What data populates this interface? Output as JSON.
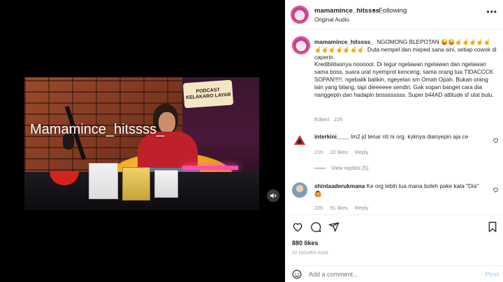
{
  "video": {
    "watermark": "Mamamince_hitssss_",
    "sign_text": "PODCAST KELAKARO LAYAR"
  },
  "header": {
    "username": "mamamince_hitssss_",
    "separator": "•",
    "follow_status": "Following",
    "audio": "Original Audio",
    "more": "•••"
  },
  "caption": {
    "username": "mamamince_hitssss_",
    "text": "NGOMONG BLEPOTAN 😜😜☝☝☝☝☝☝☝☝☝☝☝☝. Duta nempel dan meped sana sini, setiap cowok di caperin.\nKredibilitasnya noooool. Di tegur ngelawan ngelawan dan ngelawan sama boss, suara urat nyemprot kenceng, sama orang tua TIDACCCK SOPAN!!!!!. ngebalik balikin, ngeyelan sm Omah Opah. Bukan orang lain yang bilang, tapi dieeeeee sendiri. Gak sopan banget cara dia nanggepin dan hadapin bossssssss. Super b44AD attitude sf ulat bulu.",
    "meta": "Edited · 22h"
  },
  "comments": [
    {
      "username": "interkini____",
      "text": "lm2 jd tenar nti ni org. kyknya dianyepin aja ce",
      "time": "21h",
      "likes": "22 likes",
      "reply": "Reply"
    },
    {
      "username": "shintaaderukmana",
      "text": "Ke org lebih tua mana boleh pake kata \"Dia\" 🙆",
      "time": "22h",
      "likes": "91 likes",
      "reply": "Reply"
    }
  ],
  "view_replies": "View replies (5)",
  "post": {
    "likes": "880 likes",
    "date": "22 HOURS AGO"
  },
  "add_comment": {
    "placeholder": "Add a comment...",
    "post_label": "Post"
  },
  "colors": {
    "accent_pink": "#e64a8e",
    "link_blue": "#0095f6",
    "muted": "#8e8e8e"
  }
}
